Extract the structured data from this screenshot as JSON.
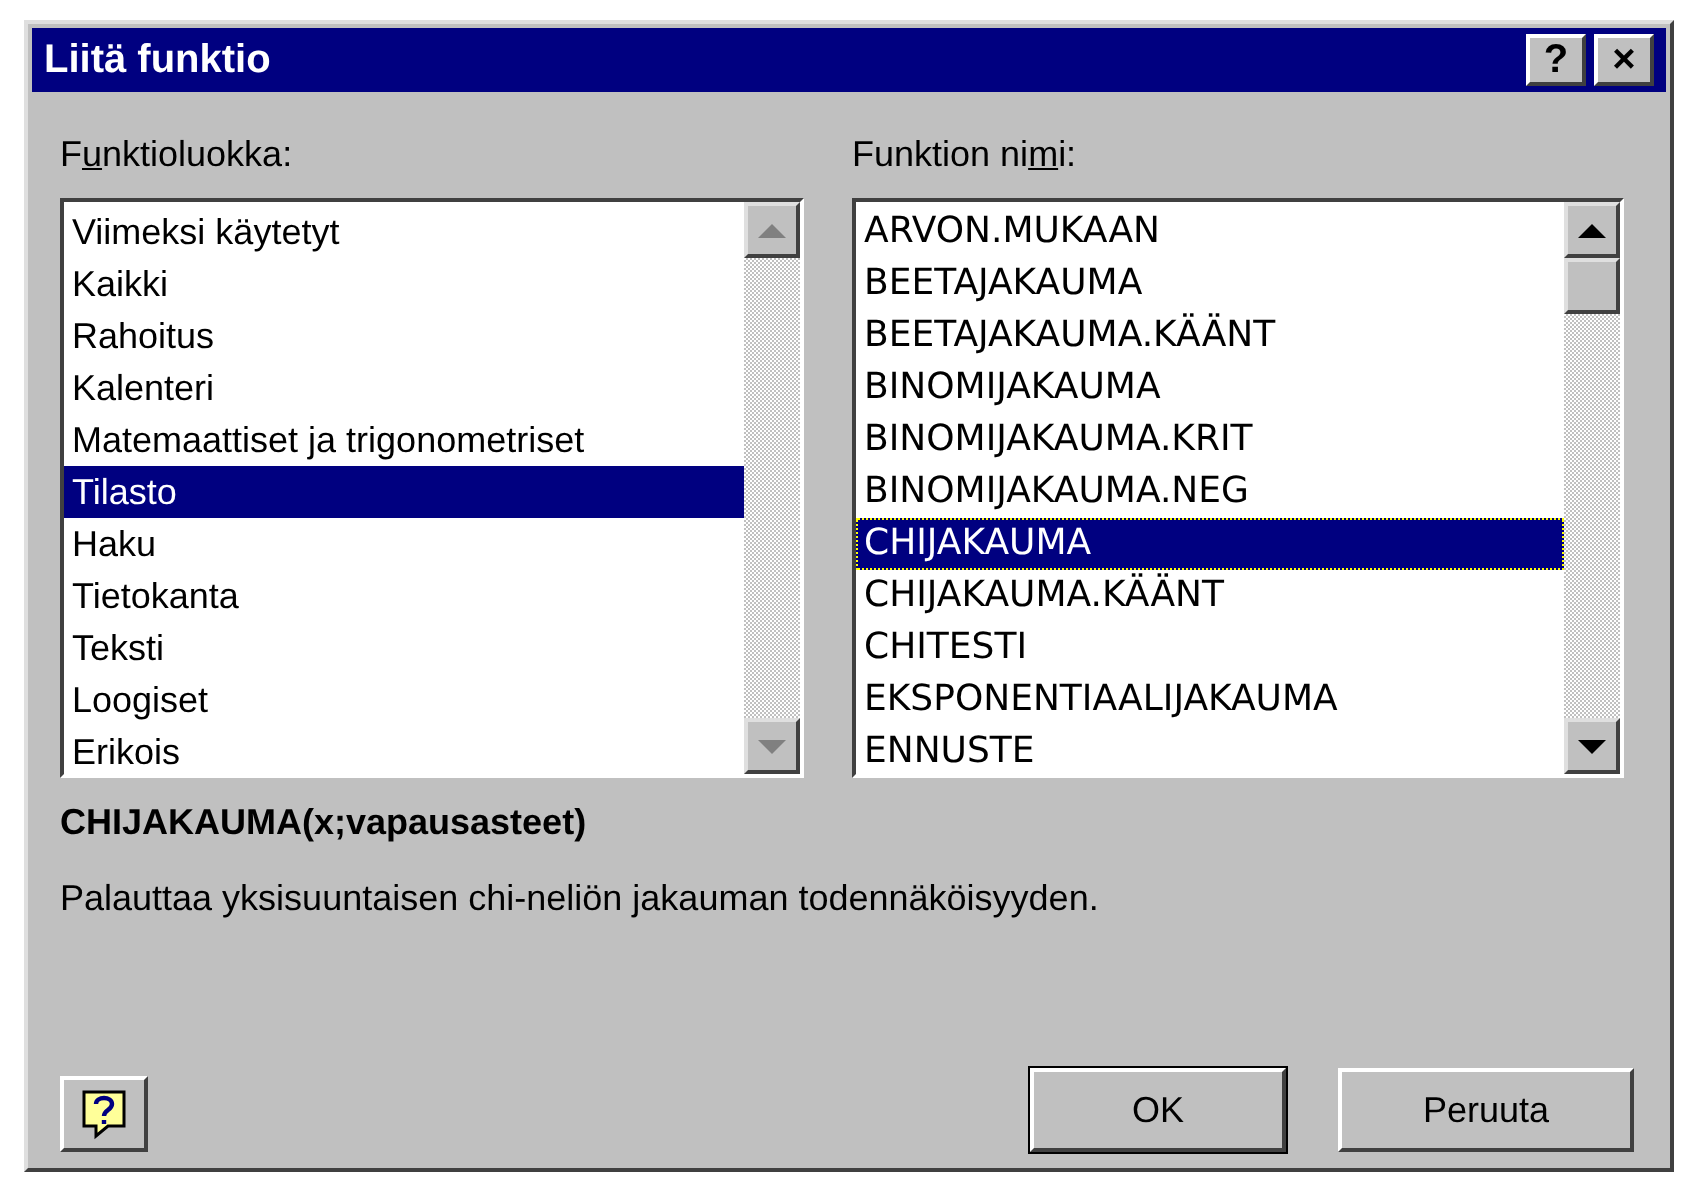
{
  "window": {
    "title": "Liitä funktio",
    "buttons": [
      "?",
      "×"
    ]
  },
  "category": {
    "label": {
      "before": "F",
      "key": "u",
      "after": "nktioluokka:"
    },
    "scrollbar_enabled": false,
    "focused": false,
    "items": [
      {
        "text": "Viimeksi käytetyt",
        "selected": false
      },
      {
        "text": "Kaikki",
        "selected": false
      },
      {
        "text": "Rahoitus",
        "selected": false
      },
      {
        "text": "Kalenteri",
        "selected": false
      },
      {
        "text": "Matemaattiset ja trigonometriset",
        "selected": false
      },
      {
        "text": "Tilasto",
        "selected": true
      },
      {
        "text": "Haku",
        "selected": false
      },
      {
        "text": "Tietokanta",
        "selected": false
      },
      {
        "text": "Teksti",
        "selected": false
      },
      {
        "text": "Loogiset",
        "selected": false
      },
      {
        "text": "Erikois",
        "selected": false
      }
    ]
  },
  "function": {
    "label": {
      "before": "Funktion ni",
      "key": "m",
      "after": "i:"
    },
    "scrollbar_enabled": true,
    "focused": true,
    "items": [
      {
        "text": "ARVON.MUKAAN",
        "selected": false
      },
      {
        "text": "BEETAJAKAUMA",
        "selected": false
      },
      {
        "text": "BEETAJAKAUMA.KÄÄNT",
        "selected": false
      },
      {
        "text": "BINOMIJAKAUMA",
        "selected": false
      },
      {
        "text": "BINOMIJAKAUMA.KRIT",
        "selected": false
      },
      {
        "text": "BINOMIJAKAUMA.NEG",
        "selected": false
      },
      {
        "text": "CHIJAKAUMA",
        "selected": true
      },
      {
        "text": "CHIJAKAUMA.KÄÄNT",
        "selected": false
      },
      {
        "text": "CHITESTI",
        "selected": false
      },
      {
        "text": "EKSPONENTIAALIJAKAUMA",
        "selected": false
      },
      {
        "text": "ENNUSTE",
        "selected": false
      }
    ]
  },
  "signature": "CHIJAKAUMA(x;vapausasteet)",
  "description": "Palauttaa yksisuuntaisen chi-neliön jakauman todennäköisyyden.",
  "buttons": [
    "OK",
    "Peruuta"
  ]
}
